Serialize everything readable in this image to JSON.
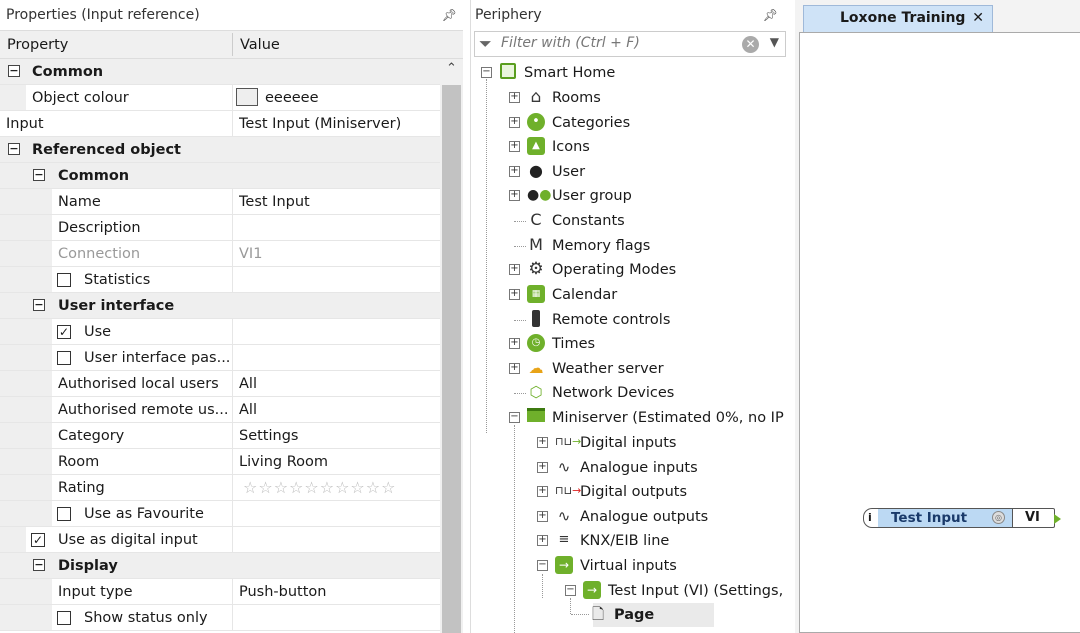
{
  "left_panel": {
    "title": "Properties (Input reference)",
    "pin": "⊥",
    "col_property": "Property",
    "col_value": "Value",
    "rows": [
      {
        "name": "Common"
      },
      {
        "name": "Object colour",
        "value": "eeeeee"
      },
      {
        "name": "Input",
        "value": "Test Input (Miniserver)"
      },
      {
        "name": "Referenced object"
      },
      {
        "name": "Common"
      },
      {
        "name": "Name",
        "value": "Test Input"
      },
      {
        "name": "Description",
        "value": ""
      },
      {
        "name": "Connection",
        "value": "VI1"
      },
      {
        "name": "Statistics",
        "checked": false
      },
      {
        "name": "User interface"
      },
      {
        "name": "Use",
        "checked": true
      },
      {
        "name": "User interface pas...",
        "checked": false
      },
      {
        "name": "Authorised local users",
        "value": "All"
      },
      {
        "name": "Authorised remote us...",
        "value": "All"
      },
      {
        "name": "Category",
        "value": "Settings"
      },
      {
        "name": "Room",
        "value": "Living Room"
      },
      {
        "name": "Rating",
        "value": "0 of 10 stars"
      },
      {
        "name": "Use as Favourite",
        "checked": false
      },
      {
        "name": "Use as digital input",
        "checked": true
      },
      {
        "name": "Display"
      },
      {
        "name": "Input type",
        "value": "Push-button"
      },
      {
        "name": "Show status only",
        "checked": false
      }
    ]
  },
  "periphery": {
    "title": "Periphery",
    "pin": "⊥",
    "filter_placeholder": "Filter with (Ctrl + F)",
    "nodes": [
      {
        "label": "Smart Home"
      },
      {
        "label": "Rooms"
      },
      {
        "label": "Categories"
      },
      {
        "label": "Icons"
      },
      {
        "label": "User"
      },
      {
        "label": "User group"
      },
      {
        "label": "Constants"
      },
      {
        "label": "Memory flags"
      },
      {
        "label": "Operating Modes"
      },
      {
        "label": "Calendar"
      },
      {
        "label": "Remote controls"
      },
      {
        "label": "Times"
      },
      {
        "label": "Weather server"
      },
      {
        "label": "Network Devices"
      },
      {
        "label": "Miniserver (Estimated 0%, no IP"
      },
      {
        "label": "Digital inputs"
      },
      {
        "label": "Analogue inputs"
      },
      {
        "label": "Digital outputs"
      },
      {
        "label": "Analogue outputs"
      },
      {
        "label": "KNX/EIB line"
      },
      {
        "label": "Virtual inputs"
      },
      {
        "label": "Test Input (VI) (Settings,"
      },
      {
        "label": "Page"
      }
    ]
  },
  "canvas": {
    "tab_title": "Loxone Training",
    "tab_close": "✕",
    "block_label": "Test Input",
    "block_output": "VI"
  }
}
